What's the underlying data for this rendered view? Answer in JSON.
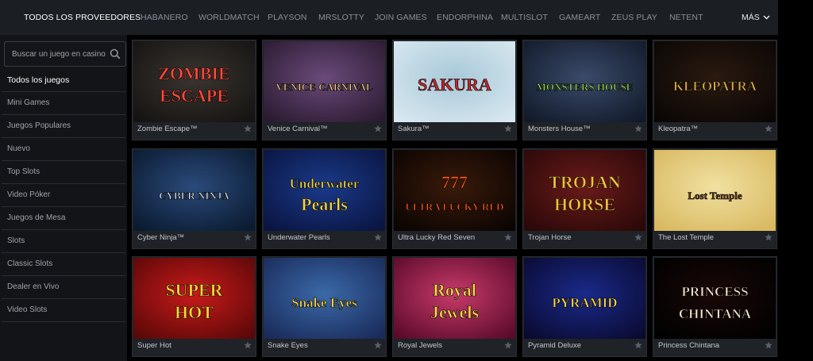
{
  "providers": {
    "items": [
      {
        "label": "TODOS LOS PROVEEDORES",
        "active": true
      },
      {
        "label": "HABANERO"
      },
      {
        "label": "WORLDMATCH"
      },
      {
        "label": "PLAYSON"
      },
      {
        "label": "MRSLOTTY"
      },
      {
        "label": "JOIN GAMES"
      },
      {
        "label": "ENDORPHINA"
      },
      {
        "label": "MULTISLOT"
      },
      {
        "label": "GAMEART"
      },
      {
        "label": "ZEUS PLAY"
      },
      {
        "label": "NETENT"
      }
    ],
    "more_label": "MÁS"
  },
  "search": {
    "placeholder": "Buscar un juego en casino..."
  },
  "categories": [
    "Todos los juegos",
    "Mini Games",
    "Juegos Populares",
    "Nuevo",
    "Top Slots",
    "Video Póker",
    "Juegos de Mesa",
    "Slots",
    "Classic Slots",
    "Dealer en Vivo",
    "Video Slots"
  ],
  "games": [
    {
      "name": "Zombie Escape™",
      "logo": [
        "ZOMBIE",
        "ESCAPE"
      ],
      "bg1": "#3a3530",
      "bg2": "#151312",
      "logo_color": "#ff4a3a",
      "icon": "zombie-escape-thumbnail"
    },
    {
      "name": "Venice Carnival™",
      "logo": [
        "VENICE CARNIVAL"
      ],
      "bg1": "#6a4a7a",
      "bg2": "#2a1a30",
      "logo_color": "#f5d27a",
      "icon": "venice-carnival-thumbnail"
    },
    {
      "name": "Sakura™",
      "logo": [
        "SAKURA"
      ],
      "bg1": "#a8c8d8",
      "bg2": "#d8e8f0",
      "logo_color": "#c0282c",
      "icon": "sakura-thumbnail"
    },
    {
      "name": "Monsters House™",
      "logo": [
        "MONSTERS HOUSE"
      ],
      "bg1": "#3a4a6a",
      "bg2": "#121a2a",
      "logo_color": "#9be04a",
      "icon": "monsters-house-thumbnail"
    },
    {
      "name": "Kleopatra™",
      "logo": [
        "KLEOPATRA"
      ],
      "bg1": "#2a1a10",
      "bg2": "#0a0604",
      "logo_color": "#d8a84a",
      "icon": "kleopatra-thumbnail"
    },
    {
      "name": "Cyber Ninja™",
      "logo": [
        "CYBER NINJA"
      ],
      "bg1": "#2a4a7a",
      "bg2": "#0a1a30",
      "logo_color": "#dfe8f5",
      "icon": "cyber-ninja-thumbnail"
    },
    {
      "name": "Underwater Pearls",
      "logo": [
        "Underwater",
        "Pearls"
      ],
      "bg1": "#1a3a8a",
      "bg2": "#0a1440",
      "logo_color": "#f5d24a",
      "icon": "underwater-pearls-thumbnail"
    },
    {
      "name": "Ultra Lucky Red Seven",
      "logo": [
        "777",
        "ULTRA LUCKY RED"
      ],
      "bg1": "#3a1a0a",
      "bg2": "#0a0402",
      "logo_color": "#ff5a1a",
      "icon": "ultra-lucky-red-seven-thumbnail"
    },
    {
      "name": "Trojan Horse",
      "logo": [
        "TROJAN",
        "HORSE"
      ],
      "bg1": "#6a1a1a",
      "bg2": "#2a0808",
      "logo_color": "#f5c03a",
      "icon": "trojan-horse-thumbnail"
    },
    {
      "name": "The Lost Temple",
      "logo": [
        "Lost Temple"
      ],
      "bg1": "#f0e0a0",
      "bg2": "#d8b860",
      "logo_color": "#6a3a1a",
      "icon": "lost-temple-thumbnail"
    },
    {
      "name": "Super Hot",
      "logo": [
        "SUPER",
        "HOT"
      ],
      "bg1": "#c81a1a",
      "bg2": "#5a0808",
      "logo_color": "#ffd83a",
      "icon": "super-hot-thumbnail"
    },
    {
      "name": "Snake Eyes",
      "logo": [
        "Snake Eyes"
      ],
      "bg1": "#3a6aa8",
      "bg2": "#1a2a5a",
      "logo_color": "#ffd84a",
      "icon": "snake-eyes-thumbnail"
    },
    {
      "name": "Royal Jewels",
      "logo": [
        "Royal",
        "Jewels"
      ],
      "bg1": "#c83a6a",
      "bg2": "#5a0a2a",
      "logo_color": "#ffd84a",
      "icon": "royal-jewels-thumbnail"
    },
    {
      "name": "Pyramid Deluxe",
      "logo": [
        "PYRAMID"
      ],
      "bg1": "#1a2a8a",
      "bg2": "#0a0a30",
      "logo_color": "#ffd84a",
      "icon": "pyramid-deluxe-thumbnail"
    },
    {
      "name": "Princess Chintana",
      "logo": [
        "PRINCESS",
        "CHINTANA"
      ],
      "bg1": "#1a0808",
      "bg2": "#000000",
      "logo_color": "#f5e6c8",
      "icon": "princess-chintana-thumbnail"
    }
  ]
}
